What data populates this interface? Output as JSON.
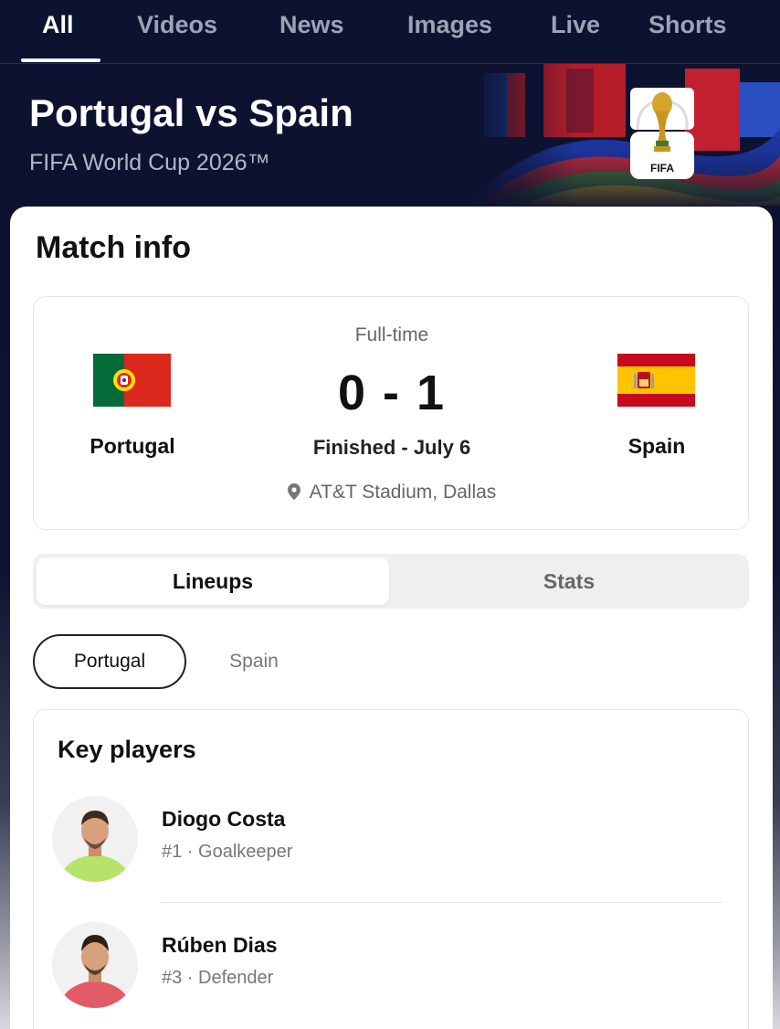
{
  "tabs": [
    {
      "label": "All",
      "active": true
    },
    {
      "label": "Videos",
      "active": false
    },
    {
      "label": "News",
      "active": false
    },
    {
      "label": "Images",
      "active": false
    },
    {
      "label": "Live",
      "active": false
    },
    {
      "label": "Shorts",
      "active": false
    }
  ],
  "hero": {
    "title": "Portugal vs Spain",
    "subtitle": "FIFA World Cup 2026™",
    "logo_text": "FIFA",
    "logo_icon": "world-cup-trophy-icon"
  },
  "match_info": {
    "heading": "Match info",
    "status": "Full-time",
    "score": "0 - 1",
    "result": "Finished - July 6",
    "venue": "AT&T Stadium, Dallas",
    "venue_icon": "location-pin-icon",
    "home": {
      "name": "Portugal",
      "flag": "portugal-flag-icon"
    },
    "away": {
      "name": "Spain",
      "flag": "spain-flag-icon"
    }
  },
  "segment": {
    "lineups_label": "Lineups",
    "stats_label": "Stats",
    "selected": "Lineups"
  },
  "team_toggle": {
    "selected_label": "Portugal",
    "other_label": "Spain"
  },
  "key_players": {
    "heading": "Key players",
    "players": [
      {
        "name": "Diogo Costa",
        "meta": "#1 · Goalkeeper",
        "kit_color": "#b6e36a"
      },
      {
        "name": "Rúben Dias",
        "meta": "#3 · Defender",
        "kit_color": "#e25b66"
      }
    ]
  },
  "colors": {
    "background": "#0d1230",
    "portugal_green": "#046a38",
    "portugal_red": "#da291c",
    "spain_red": "#c60b1e",
    "spain_yellow": "#ffc400"
  }
}
